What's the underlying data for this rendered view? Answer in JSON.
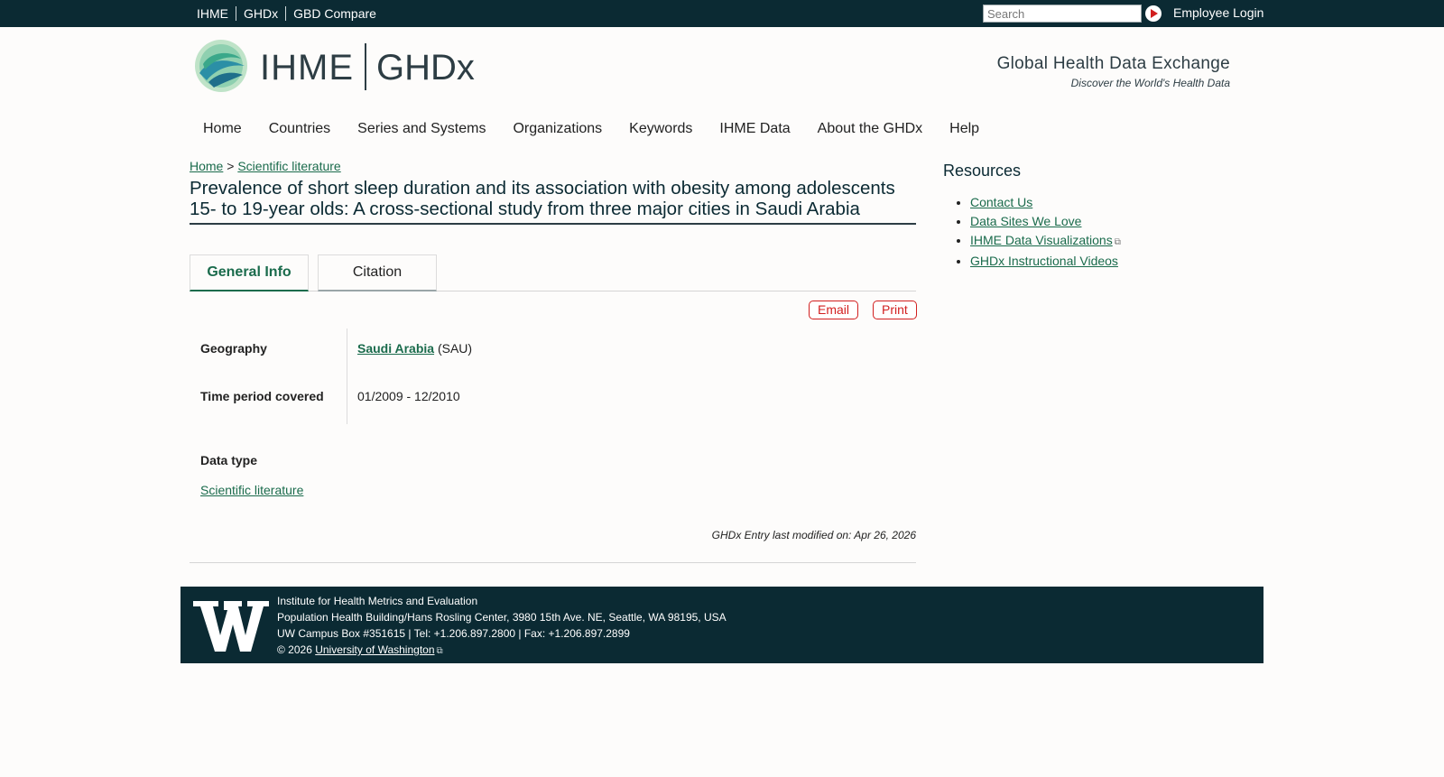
{
  "topbar": {
    "links": [
      "IHME",
      "GHDx",
      "GBD Compare"
    ],
    "search_placeholder": "Search",
    "login_label": "Employee Login"
  },
  "header": {
    "logo_left": "IHME",
    "logo_right": "GHDx",
    "tagline": "Global Health Data Exchange",
    "subtagline": "Discover the World's Health Data"
  },
  "nav": [
    "Home",
    "Countries",
    "Series and Systems",
    "Organizations",
    "Keywords",
    "IHME Data",
    "About the GHDx",
    "Help"
  ],
  "breadcrumb": {
    "home": "Home",
    "sep": ">",
    "current": "Scientific literature"
  },
  "page_title": "Prevalence of short sleep duration and its association with obesity among adolescents 15- to 19-year olds: A cross-sectional study from three major cities in Saudi Arabia",
  "tabs": [
    "General Info",
    "Citation"
  ],
  "actions": {
    "email": "Email",
    "print": "Print"
  },
  "fields": {
    "geography_label": "Geography",
    "geography_link": "Saudi Arabia",
    "geography_code": "(SAU)",
    "time_label": "Time period covered",
    "time_value": "01/2009 - 12/2010",
    "datatype_label": "Data type",
    "datatype_link": "Scientific literature"
  },
  "modified": "GHDx Entry last modified on: Apr 26, 2026",
  "sidebar": {
    "title": "Resources",
    "items": [
      "Contact Us",
      "Data Sites We Love",
      "IHME Data Visualizations",
      "GHDx Instructional Videos"
    ]
  },
  "footer": {
    "line1": "Institute for Health Metrics and Evaluation",
    "line2": "Population Health Building/Hans Rosling Center, 3980 15th Ave. NE, Seattle, WA 98195, USA",
    "line3": "UW Campus Box #351615 | Tel: +1.206.897.2800 | Fax: +1.206.897.2899",
    "copyright": "© 2026",
    "uw_link": "University of Washington"
  }
}
